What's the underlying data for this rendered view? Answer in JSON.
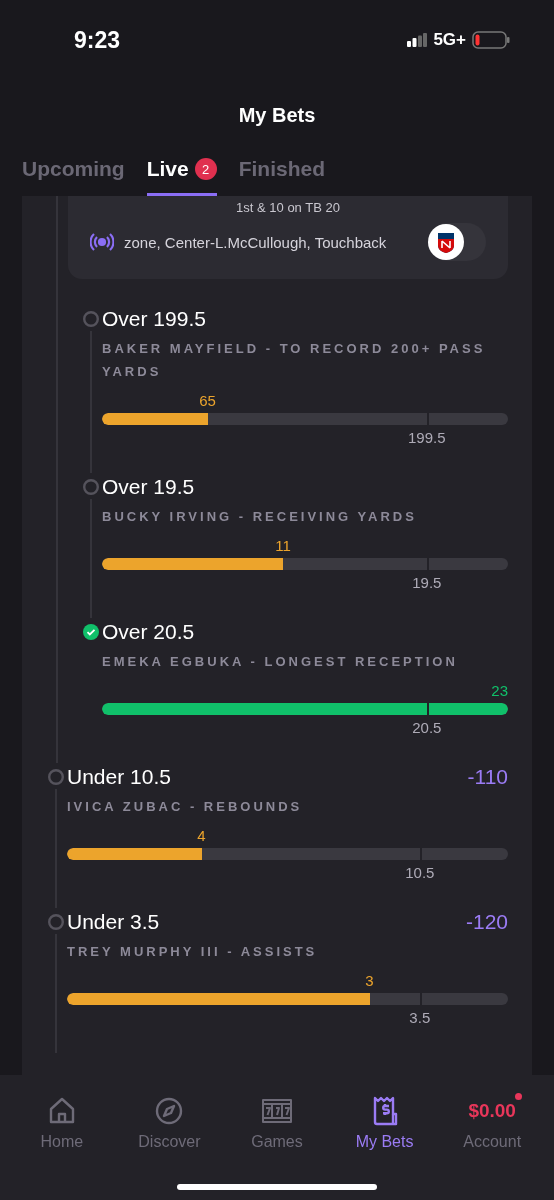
{
  "status_bar": {
    "time": "9:23",
    "network": "5G+"
  },
  "header": {
    "title": "My Bets"
  },
  "tabs": [
    {
      "label": "Upcoming",
      "selected": false
    },
    {
      "label": "Live",
      "selected": true,
      "badge": "2"
    },
    {
      "label": "Finished",
      "selected": false
    }
  ],
  "game": {
    "down_distance": "1st & 10 on TB 20",
    "play_feed": "zone, Center-L.McCullough, Touchback",
    "legs": [
      {
        "title": "Over 199.5",
        "description": "BAKER MAYFIELD - TO RECORD 200+ PASS YARDS",
        "current": "65",
        "line": "199.5",
        "level": 0.26,
        "hit": false
      },
      {
        "title": "Over 19.5",
        "description": "BUCKY IRVING - RECEIVING YARDS",
        "current": "11",
        "line": "19.5",
        "level": 0.446,
        "hit": false
      },
      {
        "title": "Over 20.5",
        "description": "EMEKA EGBUKA - LONGEST RECEPTION",
        "current": "23",
        "line": "20.5",
        "level": 1,
        "hit": true
      }
    ]
  },
  "legs": [
    {
      "title": "Under 10.5",
      "odds": "-110",
      "description": "IVICA ZUBAC - REBOUNDS",
      "current": "4",
      "line": "10.5",
      "level": 0.305,
      "hit": false
    },
    {
      "title": "Under 3.5",
      "odds": "-120",
      "description": "TREY MURPHY III - ASSISTS",
      "current": "3",
      "line": "3.5",
      "level": 0.686,
      "hit": false
    }
  ],
  "nav": [
    {
      "kind": "home",
      "label": "Home",
      "selected": false
    },
    {
      "kind": "discover",
      "label": "Discover",
      "selected": false
    },
    {
      "kind": "games",
      "label": "Games",
      "selected": false
    },
    {
      "kind": "bets",
      "label": "My Bets",
      "selected": true
    },
    {
      "kind": "account",
      "label": "Account",
      "balance": "$0.00",
      "selected": false
    }
  ]
}
